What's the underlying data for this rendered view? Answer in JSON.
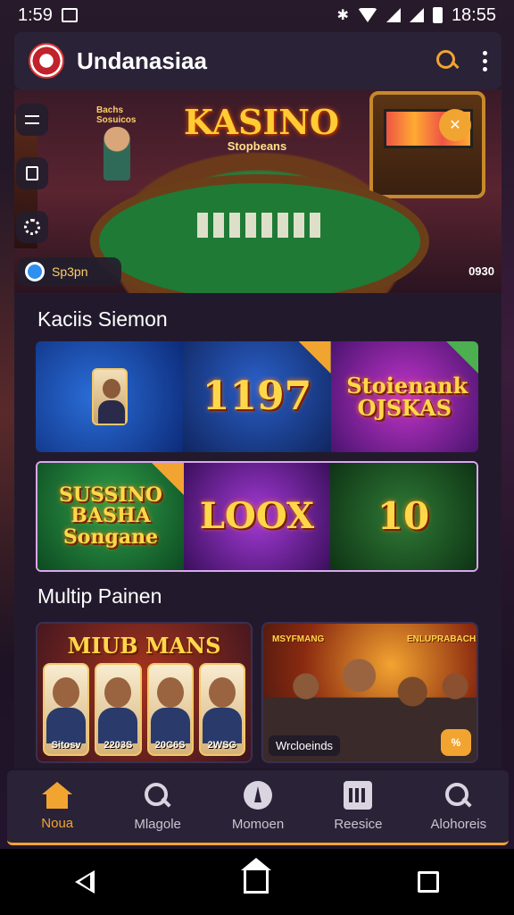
{
  "status_bar": {
    "time": "1:59",
    "clock_right": "18:55"
  },
  "app_bar": {
    "title": "Undanasiaa",
    "logo_icon": "casino-logo",
    "search_icon": "search-icon",
    "menu_icon": "more-vert-icon"
  },
  "hero": {
    "title": "KASINO",
    "subtitle": "Stopbeans",
    "left_tag": "Bachs Sosuicos",
    "chip_label": "Sp3pn",
    "count": "0930",
    "side_buttons": [
      "menu-icon",
      "grid-icon",
      "settings-icon"
    ]
  },
  "section1": {
    "title": "Kaciis Siemon",
    "row1": [
      {
        "name": "Portrait bingo",
        "label": "",
        "color": "#2a6ed8"
      },
      {
        "name": "1197",
        "label": "1197",
        "color": "#2a5fc8"
      },
      {
        "name": "Ojskas",
        "label": "Stoienank OJSKAS",
        "color": "#c034c8"
      }
    ],
    "row2": [
      {
        "name": "Basha",
        "label": "SUSSINO BASHA Songane",
        "color": "#2fa04a"
      },
      {
        "name": "Loox",
        "label": "LOOX",
        "color": "#a33ad6"
      },
      {
        "name": "10",
        "label": "10",
        "color": "#2f7a36"
      }
    ]
  },
  "section2": {
    "title": "Multip Painen",
    "featured": [
      {
        "title": "MIUB MANS",
        "cards": [
          "Sitosv",
          "2203S",
          "20C6S",
          "2WSG"
        ]
      },
      {
        "left_sub": "MSYFMANG",
        "right_sub": "ENLUPRABACHA",
        "caption": "Wrcloeinds",
        "badge": "%"
      }
    ]
  },
  "bottom_nav": {
    "items": [
      {
        "label": "Noua",
        "icon": "home-icon",
        "active": true
      },
      {
        "label": "Mlagole",
        "icon": "search-icon",
        "active": false
      },
      {
        "label": "Momoen",
        "icon": "compass-icon",
        "active": false
      },
      {
        "label": "Reesice",
        "icon": "receipt-icon",
        "active": false
      },
      {
        "label": "Alohoreis",
        "icon": "search-icon",
        "active": false
      }
    ]
  },
  "colors": {
    "accent": "#f2a431",
    "surface": "#2a2236",
    "background": "#1b1222"
  }
}
